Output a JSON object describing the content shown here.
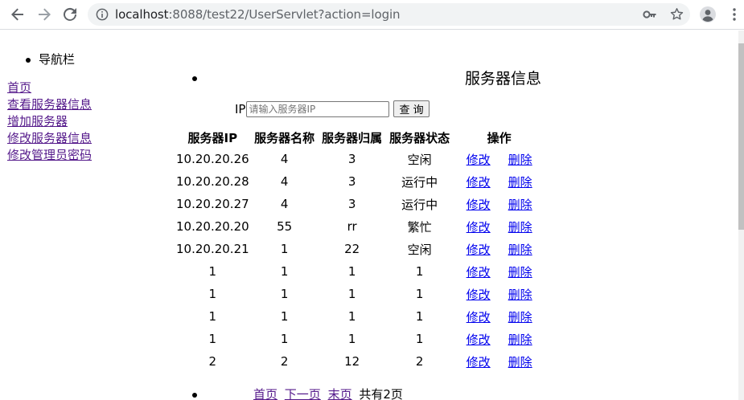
{
  "browser": {
    "url_host": "localhost",
    "url_path": ":8088/test22/UserServlet?action=login"
  },
  "nav": {
    "heading": "导航栏",
    "links": [
      "首页",
      "查看服务器信息",
      "增加服务器",
      "修改服务器信息",
      "修改管理员密码"
    ]
  },
  "main": {
    "title": "服务器信息",
    "search": {
      "label": "IP",
      "placeholder": "请输入服务器IP",
      "button": "查 询"
    },
    "table": {
      "headers": [
        "服务器IP",
        "服务器名称",
        "服务器归属",
        "服务器状态",
        "操作"
      ],
      "rows": [
        {
          "ip": "10.20.20.26",
          "name": "4",
          "owner": "3",
          "state": "空闲"
        },
        {
          "ip": "10.20.20.28",
          "name": "4",
          "owner": "3",
          "state": "运行中"
        },
        {
          "ip": "10.20.20.27",
          "name": "4",
          "owner": "3",
          "state": "运行中"
        },
        {
          "ip": "10.20.20.20",
          "name": "55",
          "owner": "rr",
          "state": "繁忙"
        },
        {
          "ip": "10.20.20.21",
          "name": "1",
          "owner": "22",
          "state": "空闲"
        },
        {
          "ip": "1",
          "name": "1",
          "owner": "1",
          "state": "1"
        },
        {
          "ip": "1",
          "name": "1",
          "owner": "1",
          "state": "1"
        },
        {
          "ip": "1",
          "name": "1",
          "owner": "1",
          "state": "1"
        },
        {
          "ip": "1",
          "name": "1",
          "owner": "1",
          "state": "1"
        },
        {
          "ip": "2",
          "name": "2",
          "owner": "12",
          "state": "2"
        }
      ],
      "edit_label": "修改",
      "delete_label": "删除"
    },
    "pager": {
      "first": "首页",
      "next": "下一页",
      "last": "末页",
      "summary": "共有2页"
    }
  },
  "colors": {
    "link": "#0000ee",
    "visited_link": "#551a8b"
  }
}
